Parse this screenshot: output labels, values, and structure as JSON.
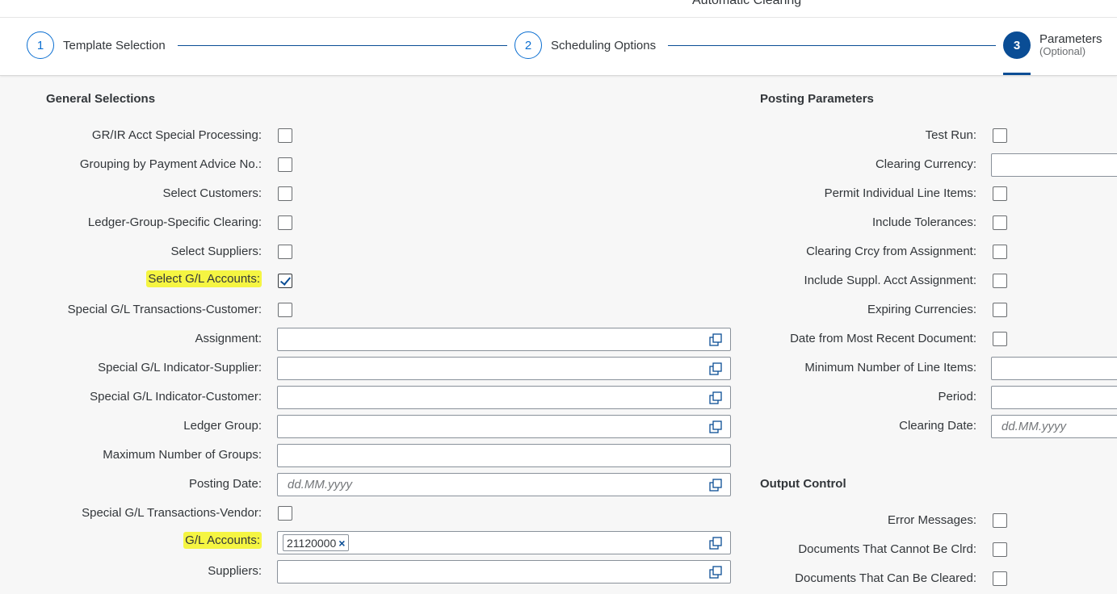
{
  "app_title": "Automatic Clearing",
  "steps": [
    {
      "number": "1",
      "label": "Template Selection"
    },
    {
      "number": "2",
      "label": "Scheduling Options"
    },
    {
      "number": "3",
      "label": "Parameters",
      "sublabel": "(Optional)"
    }
  ],
  "general": {
    "title": "General Selections",
    "gr_ir": {
      "label": "GR/IR Acct Special Processing:",
      "checked": false
    },
    "grouping_payment_advice": {
      "label": "Grouping by Payment Advice No.:",
      "checked": false
    },
    "select_customers": {
      "label": "Select Customers:",
      "checked": false
    },
    "ledger_group_clearing": {
      "label": "Ledger-Group-Specific Clearing:",
      "checked": false
    },
    "select_suppliers": {
      "label": "Select Suppliers:",
      "checked": false
    },
    "select_gl_accounts": {
      "label": "Select G/L Accounts:",
      "checked": true
    },
    "special_gl_customer": {
      "label": "Special G/L Transactions-Customer:",
      "checked": false
    },
    "assignment": {
      "label": "Assignment:",
      "value": ""
    },
    "special_gl_ind_supplier": {
      "label": "Special G/L Indicator-Supplier:",
      "value": ""
    },
    "special_gl_ind_customer": {
      "label": "Special G/L Indicator-Customer:",
      "value": ""
    },
    "ledger_group": {
      "label": "Ledger Group:",
      "value": ""
    },
    "max_groups": {
      "label": "Maximum Number of Groups:",
      "value": ""
    },
    "posting_date": {
      "label": "Posting Date:",
      "placeholder": "dd.MM.yyyy"
    },
    "special_gl_vendor": {
      "label": "Special G/L Transactions-Vendor:",
      "checked": false
    },
    "gl_accounts": {
      "label": "G/L Accounts:",
      "token": "21120000",
      "token_remove": "×"
    },
    "suppliers": {
      "label": "Suppliers:",
      "value": ""
    }
  },
  "posting": {
    "title": "Posting Parameters",
    "test_run": {
      "label": "Test Run:",
      "checked": false
    },
    "clearing_currency": {
      "label": "Clearing Currency:",
      "value": ""
    },
    "permit_individual": {
      "label": "Permit Individual Line Items:",
      "checked": false
    },
    "include_tolerances": {
      "label": "Include Tolerances:",
      "checked": false
    },
    "clearing_crcy_assignment": {
      "label": "Clearing Crcy from Assignment:",
      "checked": false
    },
    "include_suppl_assignment": {
      "label": "Include Suppl. Acct Assignment:",
      "checked": false
    },
    "expiring_currencies": {
      "label": "Expiring Currencies:",
      "checked": false
    },
    "date_recent_document": {
      "label": "Date from Most Recent Document:",
      "checked": false
    },
    "min_line_items": {
      "label": "Minimum Number of Line Items:",
      "value": ""
    },
    "period": {
      "label": "Period:",
      "value": ""
    },
    "clearing_date": {
      "label": "Clearing Date:",
      "placeholder": "dd.MM.yyyy"
    }
  },
  "output": {
    "title": "Output Control",
    "error_messages": {
      "label": "Error Messages:",
      "checked": false
    },
    "docs_cannot_clear": {
      "label": "Documents That Cannot Be Clrd:",
      "checked": false
    },
    "docs_can_clear": {
      "label": "Documents That Can Be Cleared:",
      "checked": false
    }
  },
  "colors": {
    "accent": "#0a4d95",
    "highlight": "#f5f542"
  }
}
